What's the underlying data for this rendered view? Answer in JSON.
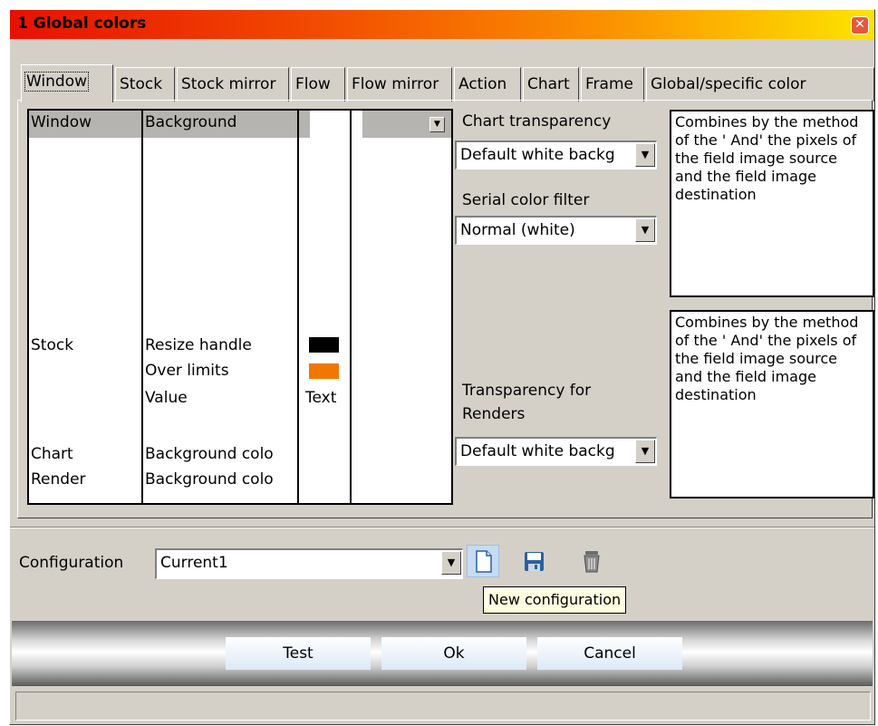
{
  "window": {
    "title": "1  Global colors",
    "close_icon": "close-icon"
  },
  "tabs": [
    {
      "label": "Window",
      "active": true
    },
    {
      "label": "Stock"
    },
    {
      "label": "Stock mirror"
    },
    {
      "label": "Flow"
    },
    {
      "label": "Flow mirror"
    },
    {
      "label": "Action"
    },
    {
      "label": "Chart"
    },
    {
      "label": "Frame"
    },
    {
      "label": "Global/specific color"
    }
  ],
  "grid": {
    "rows": [
      {
        "object": "Window",
        "element": "Background",
        "selected": true
      },
      {
        "object": "Stock",
        "element": "Resize handle",
        "color": "#000000"
      },
      {
        "object": "",
        "element": "Over limits",
        "color": "#f07800"
      },
      {
        "object": "",
        "element": "Value",
        "value_text": "Text"
      },
      {
        "object": "Chart",
        "element": "Background colo"
      },
      {
        "object": "Render",
        "element": "Background colo"
      }
    ]
  },
  "chart_transparency": {
    "label": "Chart transparency",
    "value": "Default white backg"
  },
  "serial_color_filter": {
    "label": "Serial color filter",
    "value": "Normal (white)"
  },
  "render_transparency": {
    "label_line1": "Transparency for",
    "label_line2": "Renders",
    "value": "Default white backg"
  },
  "description1": "Combines by the method of the ' And' the pixels of the field image source and the field image destination",
  "description2": "Combines by the method of the ' And' the pixels of the field image source and the field image destination",
  "configuration": {
    "label": "Configuration",
    "value": "Current1",
    "tooltip": "New configuration",
    "icons": [
      "new-document-icon",
      "save-icon",
      "trash-icon"
    ]
  },
  "buttons": {
    "test": "Test",
    "ok": "Ok",
    "cancel": "Cancel"
  },
  "colors": {
    "selection": "#b6b4b0",
    "swatch_black": "#000000",
    "swatch_orange": "#f07800"
  }
}
